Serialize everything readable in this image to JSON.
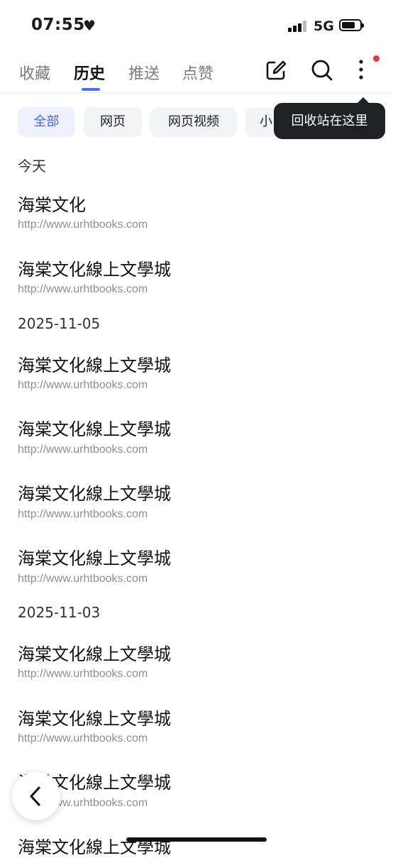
{
  "status_bar": {
    "time": "07:55",
    "network": "5G"
  },
  "header": {
    "tabs": [
      "收藏",
      "历史",
      "推送",
      "点赞"
    ],
    "active_tab": 1,
    "icons": [
      "edit-icon",
      "search-icon",
      "more-icon"
    ]
  },
  "filters": {
    "chips": [
      "全部",
      "网页",
      "网页视频",
      "小"
    ],
    "active": 0
  },
  "tooltip": {
    "text": "回收站在这里"
  },
  "history": [
    {
      "date": "今天",
      "items": [
        {
          "title": "海棠文化",
          "url": "http://www.urhtbooks.com"
        },
        {
          "title": "海棠文化線上文學城",
          "url": "http://www.urhtbooks.com"
        }
      ]
    },
    {
      "date": "2025-11-05",
      "items": [
        {
          "title": "海棠文化線上文學城",
          "url": "http://www.urhtbooks.com"
        },
        {
          "title": "海棠文化線上文學城",
          "url": "http://www.urhtbooks.com"
        },
        {
          "title": "海棠文化線上文學城",
          "url": "http://www.urhtbooks.com"
        },
        {
          "title": "海棠文化線上文學城",
          "url": "http://www.urhtbooks.com"
        }
      ]
    },
    {
      "date": "2025-11-03",
      "items": [
        {
          "title": "海棠文化線上文學城",
          "url": "http://www.urhtbooks.com"
        },
        {
          "title": "海棠文化線上文學城",
          "url": "http://www.urhtbooks.com"
        },
        {
          "title": "海棠文化線上文學城",
          "url": "http://www.urhtbooks.com"
        },
        {
          "title": "海棠文化線上文學城",
          "url": ""
        }
      ]
    }
  ],
  "colors": {
    "accent": "#4169e1",
    "tooltip_bg": "#202124",
    "badge": "#f0313c"
  }
}
